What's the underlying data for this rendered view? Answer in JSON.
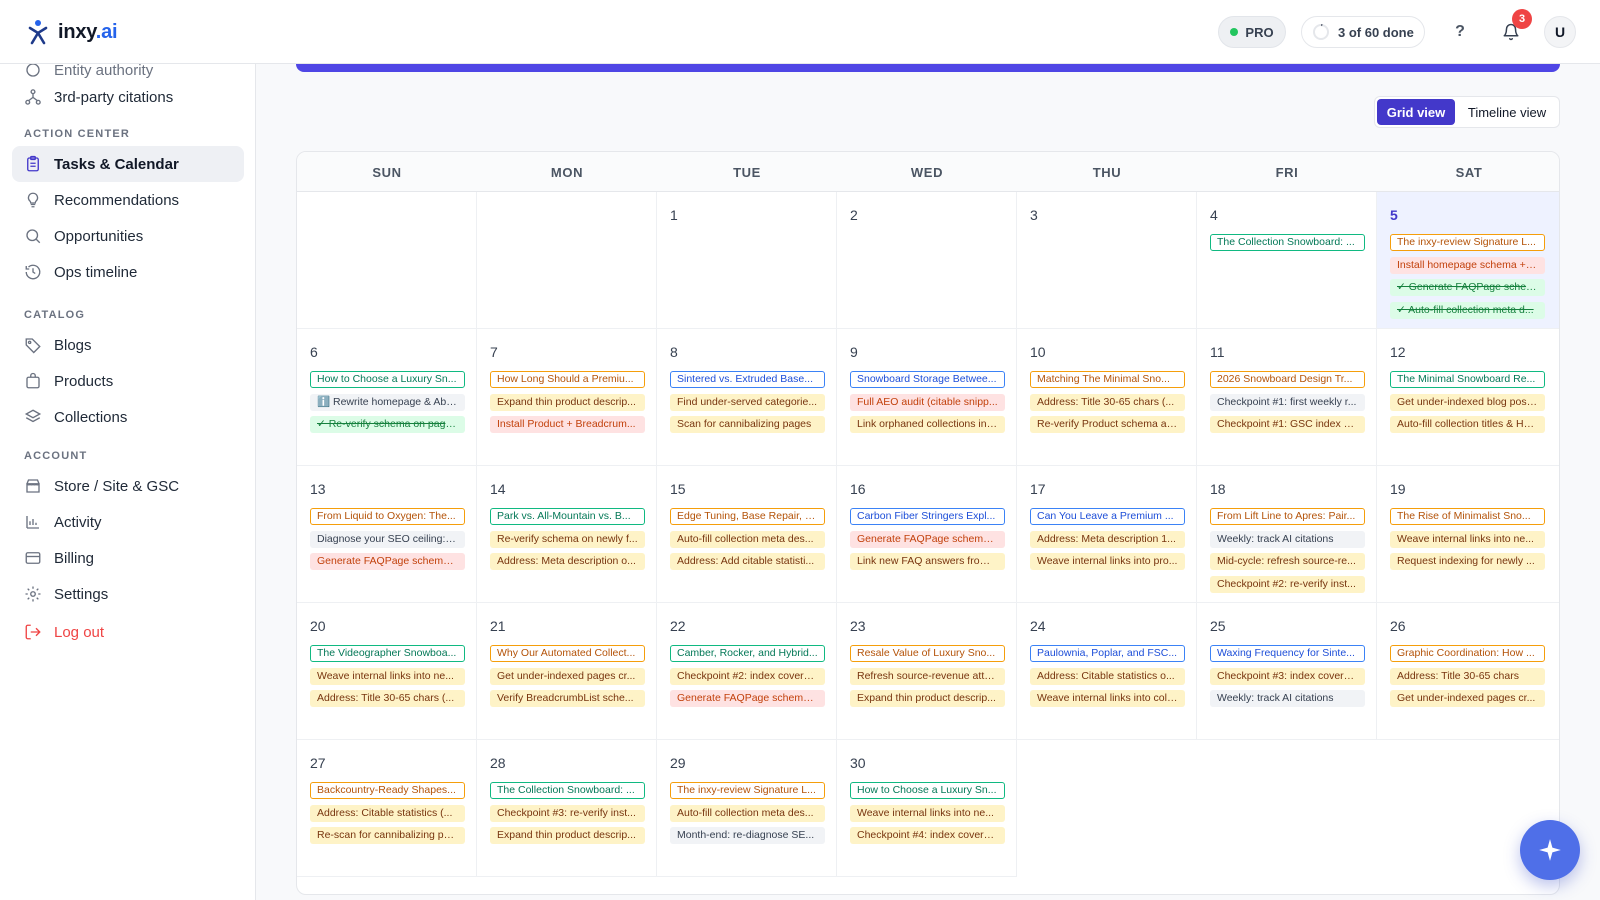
{
  "brand": {
    "name": "inxy",
    "suffix": ".ai"
  },
  "header": {
    "plan": "PRO",
    "progress_text": "3 of 60 done",
    "help_label": "?",
    "notification_count": "3",
    "avatar_initial": "U"
  },
  "sidebar": {
    "cut_item": "Entity authority",
    "top_items": [
      {
        "label": "3rd-party citations",
        "icon": "network-icon"
      }
    ],
    "sections": [
      {
        "title": "ACTION CENTER",
        "items": [
          {
            "label": "Tasks & Calendar",
            "icon": "clipboard-icon",
            "active": true
          },
          {
            "label": "Recommendations",
            "icon": "lightbulb-icon"
          },
          {
            "label": "Opportunities",
            "icon": "search-icon"
          },
          {
            "label": "Ops timeline",
            "icon": "history-icon"
          }
        ]
      },
      {
        "title": "CATALOG",
        "items": [
          {
            "label": "Blogs",
            "icon": "tag-icon"
          },
          {
            "label": "Products",
            "icon": "bag-icon"
          },
          {
            "label": "Collections",
            "icon": "layers-icon"
          }
        ]
      },
      {
        "title": "ACCOUNT",
        "items": [
          {
            "label": "Store / Site & GSC",
            "icon": "store-icon"
          },
          {
            "label": "Activity",
            "icon": "bar-chart-icon"
          },
          {
            "label": "Billing",
            "icon": "credit-card-icon"
          },
          {
            "label": "Settings",
            "icon": "gear-icon"
          }
        ]
      }
    ],
    "logout": "Log out"
  },
  "view_toggle": {
    "grid": "Grid view",
    "timeline": "Timeline view",
    "active": "grid"
  },
  "colors": {
    "accent": "#4f46e5",
    "teal": "#10b981",
    "orange": "#f59e0b",
    "blue": "#3b82f6",
    "danger": "#ef4444"
  },
  "calendar": {
    "weekdays": [
      "SUN",
      "MON",
      "TUE",
      "WED",
      "THU",
      "FRI",
      "SAT"
    ],
    "today": "5",
    "weeks": [
      [
        {
          "day": "",
          "tasks": []
        },
        {
          "day": "",
          "tasks": []
        },
        {
          "day": "1",
          "tasks": []
        },
        {
          "day": "2",
          "tasks": []
        },
        {
          "day": "3",
          "tasks": []
        },
        {
          "day": "4",
          "tasks": [
            {
              "text": "The Collection Snowboard: ...",
              "style": "teal"
            }
          ]
        },
        {
          "day": "5",
          "tasks": [
            {
              "text": "The inxy-review Signature L...",
              "style": "orange"
            },
            {
              "text": "Install homepage schema + i...",
              "style": "red"
            },
            {
              "text": "✓ Generate FAQPage schem...",
              "style": "done"
            },
            {
              "text": "✓ Auto-fill collection meta d...",
              "style": "done"
            }
          ]
        }
      ],
      [
        {
          "day": "6",
          "tasks": [
            {
              "text": "How to Choose a Luxury Sn...",
              "style": "teal"
            },
            {
              "text": "ℹ️ Rewrite homepage & Abo...",
              "style": "info"
            },
            {
              "text": "✓ Re-verify schema on page...",
              "style": "done"
            }
          ]
        },
        {
          "day": "7",
          "tasks": [
            {
              "text": "How Long Should a Premiu...",
              "style": "orange"
            },
            {
              "text": "Expand thin product descrip...",
              "style": "yellow"
            },
            {
              "text": "Install Product + Breadcrum...",
              "style": "red"
            }
          ]
        },
        {
          "day": "8",
          "tasks": [
            {
              "text": "Sintered vs. Extruded Base...",
              "style": "blue"
            },
            {
              "text": "Find under-served categorie...",
              "style": "yellow"
            },
            {
              "text": "Scan for cannibalizing pages",
              "style": "yellow"
            }
          ]
        },
        {
          "day": "9",
          "tasks": [
            {
              "text": "Snowboard Storage Betwee...",
              "style": "blue"
            },
            {
              "text": "Full AEO audit (citable snipp...",
              "style": "red"
            },
            {
              "text": "Link orphaned collections int...",
              "style": "yellow"
            }
          ]
        },
        {
          "day": "10",
          "tasks": [
            {
              "text": "Matching The Minimal Sno...",
              "style": "orange"
            },
            {
              "text": "Address: Title 30-65 chars (...",
              "style": "yellow"
            },
            {
              "text": "Re-verify Product schema af...",
              "style": "yellow"
            }
          ]
        },
        {
          "day": "11",
          "tasks": [
            {
              "text": "2026 Snowboard Design Tr...",
              "style": "orange"
            },
            {
              "text": "Checkpoint #1: first weekly r...",
              "style": "gray"
            },
            {
              "text": "Checkpoint #1: GSC index co...",
              "style": "yellow"
            }
          ]
        },
        {
          "day": "12",
          "tasks": [
            {
              "text": "The Minimal Snowboard Re...",
              "style": "teal"
            },
            {
              "text": "Get under-indexed blog post...",
              "style": "yellow"
            },
            {
              "text": "Auto-fill collection titles & H1...",
              "style": "yellow"
            }
          ]
        }
      ],
      [
        {
          "day": "13",
          "tasks": [
            {
              "text": "From Liquid to Oxygen: The...",
              "style": "orange"
            },
            {
              "text": "Diagnose your SEO ceiling: c...",
              "style": "gray"
            },
            {
              "text": "Generate FAQPage schema f...",
              "style": "red"
            }
          ]
        },
        {
          "day": "14",
          "tasks": [
            {
              "text": "Park vs. All-Mountain vs. B...",
              "style": "teal"
            },
            {
              "text": "Re-verify schema on newly f...",
              "style": "yellow"
            },
            {
              "text": "Address: Meta description o...",
              "style": "yellow"
            }
          ]
        },
        {
          "day": "15",
          "tasks": [
            {
              "text": "Edge Tuning, Base Repair, a...",
              "style": "orange"
            },
            {
              "text": "Auto-fill collection meta des...",
              "style": "yellow"
            },
            {
              "text": "Address: Add citable statisti...",
              "style": "yellow"
            }
          ]
        },
        {
          "day": "16",
          "tasks": [
            {
              "text": "Carbon Fiber Stringers Expl...",
              "style": "blue"
            },
            {
              "text": "Generate FAQPage schema f...",
              "style": "red"
            },
            {
              "text": "Link new FAQ answers from ...",
              "style": "yellow"
            }
          ]
        },
        {
          "day": "17",
          "tasks": [
            {
              "text": "Can You Leave a Premium ...",
              "style": "blue"
            },
            {
              "text": "Address: Meta description 1...",
              "style": "yellow"
            },
            {
              "text": "Weave internal links into pro...",
              "style": "yellow"
            }
          ]
        },
        {
          "day": "18",
          "tasks": [
            {
              "text": "From Lift Line to Apres: Pair...",
              "style": "orange"
            },
            {
              "text": "Weekly: track AI citations",
              "style": "gray"
            },
            {
              "text": "Mid-cycle: refresh source-re...",
              "style": "yellow"
            },
            {
              "text": "Checkpoint #2: re-verify inst...",
              "style": "yellow"
            }
          ]
        },
        {
          "day": "19",
          "tasks": [
            {
              "text": "The Rise of Minimalist Sno...",
              "style": "orange"
            },
            {
              "text": "Weave internal links into ne...",
              "style": "yellow"
            },
            {
              "text": "Request indexing for newly ...",
              "style": "yellow"
            }
          ]
        }
      ],
      [
        {
          "day": "20",
          "tasks": [
            {
              "text": "The Videographer Snowboa...",
              "style": "teal"
            },
            {
              "text": "Weave internal links into ne...",
              "style": "yellow"
            },
            {
              "text": "Address: Title 30-65 chars (...",
              "style": "yellow"
            }
          ]
        },
        {
          "day": "21",
          "tasks": [
            {
              "text": "Why Our Automated Collect...",
              "style": "orange"
            },
            {
              "text": "Get under-indexed pages cr...",
              "style": "yellow"
            },
            {
              "text": "Verify BreadcrumbList sche...",
              "style": "yellow"
            }
          ]
        },
        {
          "day": "22",
          "tasks": [
            {
              "text": "Camber, Rocker, and Hybrid...",
              "style": "teal"
            },
            {
              "text": "Checkpoint #2: index covera...",
              "style": "yellow"
            },
            {
              "text": "Generate FAQPage schema f...",
              "style": "red"
            }
          ]
        },
        {
          "day": "23",
          "tasks": [
            {
              "text": "Resale Value of Luxury Sno...",
              "style": "orange"
            },
            {
              "text": "Refresh source-revenue attri...",
              "style": "yellow"
            },
            {
              "text": "Expand thin product descrip...",
              "style": "yellow"
            }
          ]
        },
        {
          "day": "24",
          "tasks": [
            {
              "text": "Paulownia, Poplar, and FSC...",
              "style": "blue"
            },
            {
              "text": "Address: Citable statistics o...",
              "style": "yellow"
            },
            {
              "text": "Weave internal links into coll...",
              "style": "yellow"
            }
          ]
        },
        {
          "day": "25",
          "tasks": [
            {
              "text": "Waxing Frequency for Sinte...",
              "style": "blue"
            },
            {
              "text": "Checkpoint #3: index covera...",
              "style": "yellow"
            },
            {
              "text": "Weekly: track AI citations",
              "style": "gray"
            }
          ]
        },
        {
          "day": "26",
          "tasks": [
            {
              "text": "Graphic Coordination: How ...",
              "style": "orange"
            },
            {
              "text": "Address: Title 30-65 chars",
              "style": "yellow"
            },
            {
              "text": "Get under-indexed pages cr...",
              "style": "yellow"
            }
          ]
        }
      ],
      [
        {
          "day": "27",
          "tasks": [
            {
              "text": "Backcountry-Ready Shapes...",
              "style": "orange"
            },
            {
              "text": "Address: Citable statistics (...",
              "style": "yellow"
            },
            {
              "text": "Re-scan for cannibalizing pa...",
              "style": "yellow"
            }
          ]
        },
        {
          "day": "28",
          "tasks": [
            {
              "text": "The Collection Snowboard: ...",
              "style": "teal"
            },
            {
              "text": "Checkpoint #3: re-verify inst...",
              "style": "yellow"
            },
            {
              "text": "Expand thin product descrip...",
              "style": "yellow"
            }
          ]
        },
        {
          "day": "29",
          "tasks": [
            {
              "text": "The inxy-review Signature L...",
              "style": "orange"
            },
            {
              "text": "Auto-fill collection meta des...",
              "style": "yellow"
            },
            {
              "text": "Month-end: re-diagnose SE...",
              "style": "gray"
            }
          ]
        },
        {
          "day": "30",
          "tasks": [
            {
              "text": "How to Choose a Luxury Sn...",
              "style": "teal"
            },
            {
              "text": "Weave internal links into ne...",
              "style": "yellow"
            },
            {
              "text": "Checkpoint #4: index covera...",
              "style": "yellow"
            }
          ]
        }
      ]
    ]
  }
}
